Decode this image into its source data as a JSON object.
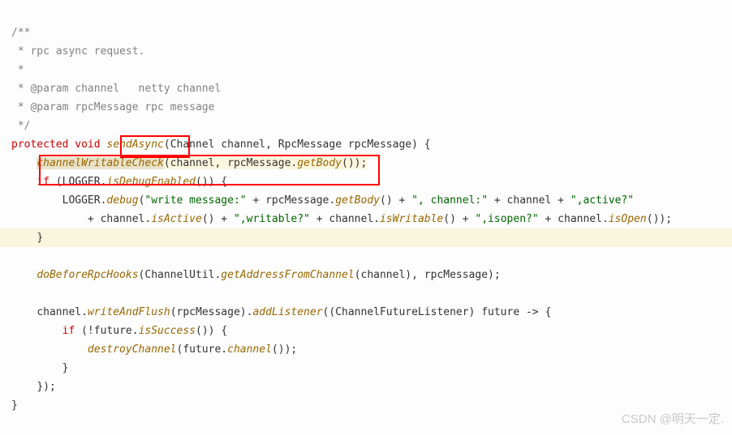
{
  "code": {
    "c1": "/**",
    "c2": " * rpc async request.",
    "c3": " *",
    "c4": " * @param channel   netty channel",
    "c5": " * @param rpcMessage rpc message",
    "c6": " */",
    "kw_protected": "protected",
    "kw_void": "void",
    "m_sendAsync": "sendAsync",
    "sig_params": "(Channel channel, RpcMessage rpcMessage) {",
    "m_channelWritableCheck": "channelWritableCheck",
    "l_cwc_open": "(channel, rpcMessage.",
    "m_getBody": "getBody",
    "l_cwc_close": "());",
    "kw_if": "if",
    "l_if_logger": " (LOGGER.",
    "m_isDebugEnabled": "isDebugEnabled",
    "l_if_close": "()) {",
    "l_logger": "LOGGER.",
    "m_debug": "debug",
    "l_debug_a": "(",
    "s_write": "\"write message:\"",
    "l_plus1": " + rpcMessage.",
    "l_plus2": "() + ",
    "s_channel": "\", channel:\"",
    "l_plus3": " + channel + ",
    "s_active": "\",active?\"",
    "l_cont": "+ channel.",
    "m_isActive": "isActive",
    "s_writable": "\",writable?\"",
    "m_isWritable": "isWritable",
    "s_isopen": "\",isopen?\"",
    "m_isOpen": "isOpen",
    "l_end_debug": "());",
    "l_brace_close": "}",
    "m_doBeforeRpcHooks": "doBeforeRpcHooks",
    "l_hooks_a": "(ChannelUtil.",
    "m_getAddressFromChannel": "getAddressFromChannel",
    "l_hooks_b": "(channel), rpcMessage);",
    "l_channel": "channel.",
    "m_writeAndFlush": "writeAndFlush",
    "l_wf_a": "(rpcMessage).",
    "m_addListener": "addListener",
    "l_al_a": "((ChannelFutureListener) future -> {",
    "l_if_future": " (!future.",
    "m_isSuccess": "isSuccess",
    "m_destroyChannel": "destroyChannel",
    "l_dc_a": "(future.",
    "m_channelMethod": "channel",
    "l_dc_b": "());",
    "l_end_lambda": "});"
  },
  "watermark": "CSDN @明天一定."
}
